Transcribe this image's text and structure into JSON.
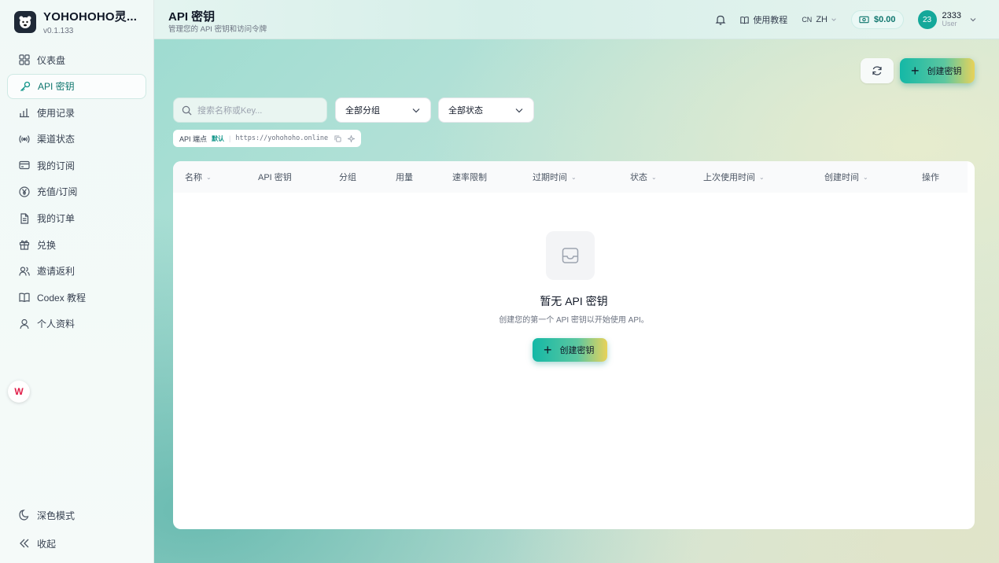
{
  "app": {
    "name": "YOHOHOHO灵...",
    "version": "v0.1.133",
    "logo_icon": "bear-logo-icon"
  },
  "sidebar": {
    "items": [
      {
        "label": "仪表盘",
        "icon": "grid-icon",
        "active": false
      },
      {
        "label": "API 密钥",
        "icon": "key-icon",
        "active": true
      },
      {
        "label": "使用记录",
        "icon": "bar-chart-icon",
        "active": false
      },
      {
        "label": "渠道状态",
        "icon": "signal-icon",
        "active": false
      },
      {
        "label": "我的订阅",
        "icon": "card-icon",
        "active": false
      },
      {
        "label": "充值/订阅",
        "icon": "yen-icon",
        "active": false
      },
      {
        "label": "我的订单",
        "icon": "document-icon",
        "active": false
      },
      {
        "label": "兑换",
        "icon": "gift-icon",
        "active": false
      },
      {
        "label": "邀请返利",
        "icon": "users-icon",
        "active": false
      },
      {
        "label": "Codex 教程",
        "icon": "book-icon",
        "active": false
      },
      {
        "label": "个人资料",
        "icon": "user-icon",
        "active": false
      }
    ],
    "bottom": [
      {
        "label": "深色模式",
        "icon": "moon-icon"
      },
      {
        "label": "收起",
        "icon": "collapse-icon"
      }
    ]
  },
  "header": {
    "title": "API 密钥",
    "subtitle": "管理您的 API 密钥和访问令牌",
    "tutorial_label": "使用教程",
    "lang_flag": "CN",
    "lang_label": "ZH",
    "balance": "$0.00",
    "user": {
      "avatar_text": "23",
      "name": "2333",
      "role": "User"
    }
  },
  "toolbar": {
    "create_label": "创建密钥",
    "search_placeholder": "搜索名称或Key...",
    "group_filter": "全部分组",
    "status_filter": "全部状态"
  },
  "endpoint": {
    "label": "API 端点",
    "tag": "默认",
    "url": "https://yohohoho.online"
  },
  "table": {
    "columns": [
      {
        "label": "名称",
        "sortable": true
      },
      {
        "label": "API 密钥",
        "sortable": false
      },
      {
        "label": "分组",
        "sortable": false
      },
      {
        "label": "用量",
        "sortable": false
      },
      {
        "label": "速率限制",
        "sortable": false
      },
      {
        "label": "过期时间",
        "sortable": true
      },
      {
        "label": "状态",
        "sortable": true
      },
      {
        "label": "上次使用时间",
        "sortable": true
      },
      {
        "label": "创建时间",
        "sortable": true
      },
      {
        "label": "操作",
        "sortable": false
      }
    ]
  },
  "empty": {
    "title": "暂无 API 密钥",
    "description": "创建您的第一个 API 密钥以开始使用 API。",
    "create_label": "创建密钥"
  },
  "colors": {
    "accent": "#14b8a6",
    "accent_end": "#e8d25a",
    "active_text": "#0f766e"
  }
}
